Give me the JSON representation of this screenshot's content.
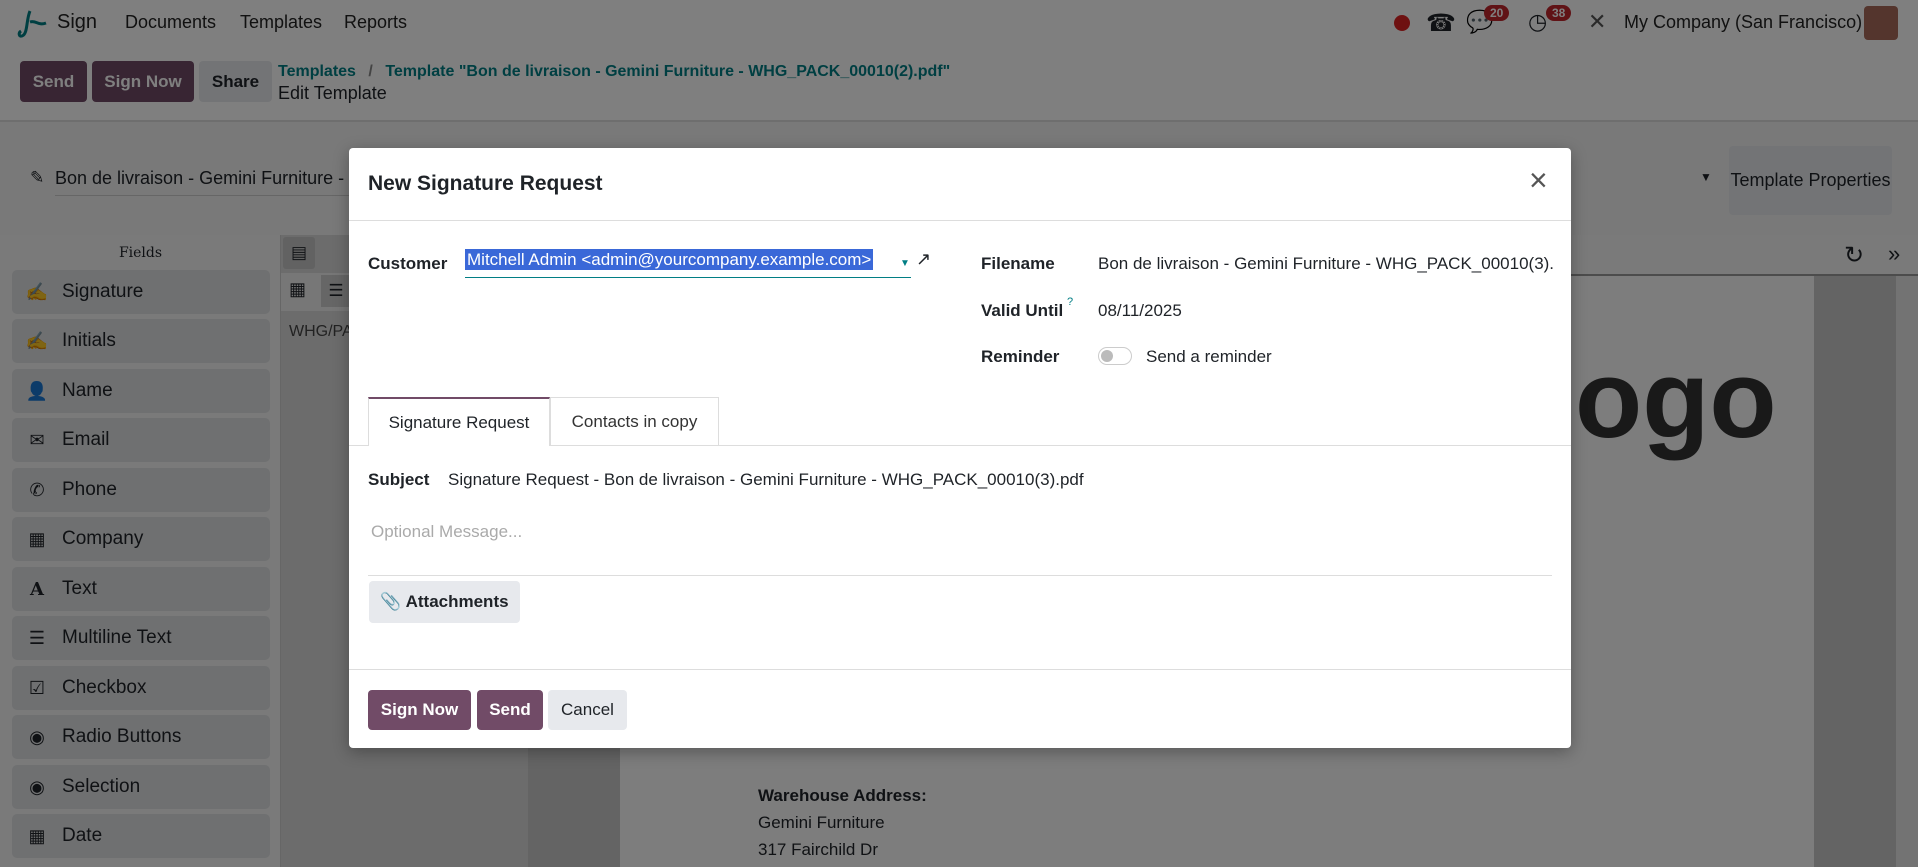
{
  "nav": {
    "app": "Sign",
    "menu": [
      "Documents",
      "Templates",
      "Reports"
    ],
    "chat_count": "20",
    "activity_count": "38",
    "company": "My Company (San Francisco)"
  },
  "control": {
    "send": "Send",
    "sign_now": "Sign Now",
    "share": "Share",
    "breadcrumb_root": "Templates",
    "breadcrumb_sep": "/",
    "breadcrumb_current": "Template \"Bon de livraison - Gemini Furniture - WHG_PACK_00010(2).pdf\"",
    "subtitle": "Edit Template"
  },
  "template": {
    "name": "Bon de livraison - Gemini Furniture - W",
    "properties": "Template Properties"
  },
  "fields": {
    "title": "Fields",
    "items": [
      "Signature",
      "Initials",
      "Name",
      "Email",
      "Phone",
      "Company",
      "Text",
      "Multiline Text",
      "Checkbox",
      "Radio Buttons",
      "Selection",
      "Date"
    ]
  },
  "mid": {
    "doc_ref": "WHG/PA"
  },
  "document": {
    "logo_text": "ogo",
    "warehouse_label": "Warehouse Address:",
    "warehouse_name": "Gemini Furniture",
    "warehouse_street": "317 Fairchild Dr"
  },
  "dialog": {
    "title": "New Signature Request",
    "customer_label": "Customer",
    "customer_value": "Mitchell Admin <admin@yourcompany.example.com>",
    "filename_label": "Filename",
    "filename_value": "Bon de livraison - Gemini Furniture - WHG_PACK_00010(3).pdf",
    "valid_label": "Valid Until",
    "valid_help": "?",
    "valid_value": "08/11/2025",
    "reminder_label": "Reminder",
    "reminder_text": "Send a reminder",
    "reminder_on": false,
    "tabs": [
      "Signature Request",
      "Contacts in copy"
    ],
    "subject_label": "Subject",
    "subject_value": "Signature Request - Bon de livraison - Gemini Furniture - WHG_PACK_00010(3).pdf",
    "message_placeholder": "Optional Message...",
    "attachments": "Attachments",
    "sign_now": "Sign Now",
    "send": "Send",
    "cancel": "Cancel"
  },
  "colors": {
    "primary": "#714b67",
    "link": "#017e84",
    "selection": "#3a68d8",
    "badge": "#c0262d"
  }
}
